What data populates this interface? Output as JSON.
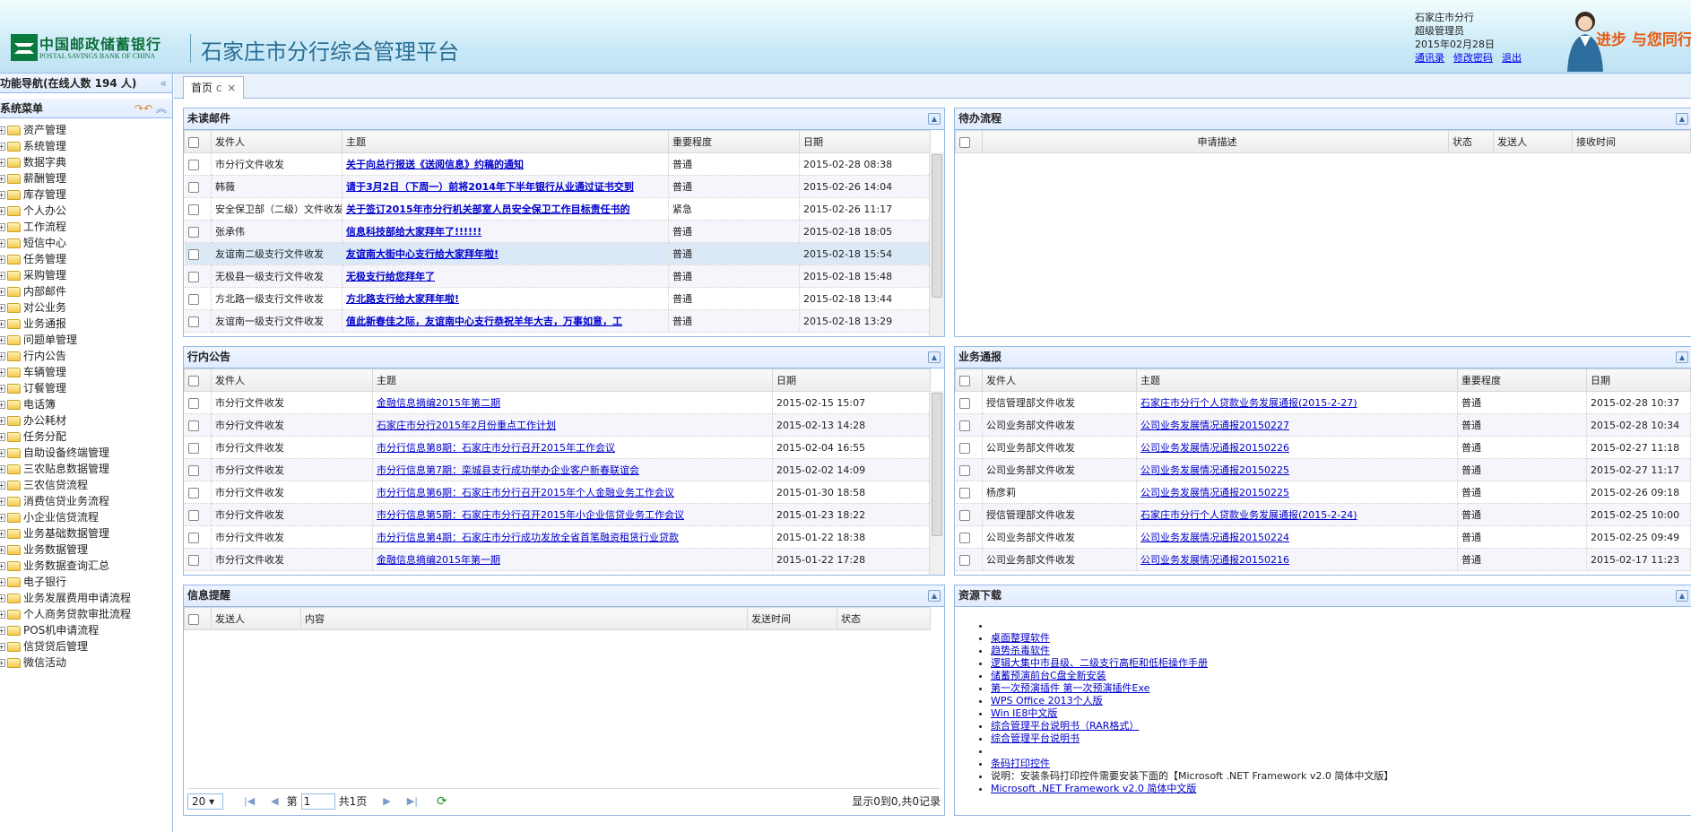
{
  "header": {
    "bank_cn": "中国邮政储蓄银行",
    "bank_en": "POSTAL SAVINGS BANK OF CHINA",
    "system_title": "石家庄市分行综合管理平台",
    "user": {
      "branch": "石家庄市分行",
      "role": "超级管理员",
      "date": "2015年02月28日",
      "links": [
        "通讯录",
        "修改密码",
        "退出"
      ]
    },
    "banner_slogan": "进步 与您同行"
  },
  "sidebar": {
    "nav_title": "功能导航(在线人数 194 人)",
    "menu_title": "系统菜单",
    "items": [
      "资产管理",
      "系统管理",
      "数据字典",
      "薪酬管理",
      "库存管理",
      "个人办公",
      "工作流程",
      "短信中心",
      "任务管理",
      "采购管理",
      "内部邮件",
      "对公业务",
      "业务通报",
      "问题单管理",
      "行内公告",
      "车辆管理",
      "订餐管理",
      "电话簿",
      "办公耗材",
      "任务分配",
      "自助设备终端管理",
      "三农贴息数据管理",
      "三农信贷流程",
      "消费信贷业务流程",
      "小企业信贷流程",
      "业务基础数据管理",
      "业务数据管理",
      "业务数据查询汇总",
      "电子银行",
      "业务发展费用申请流程",
      "个人商务贷款审批流程",
      "POS机申请流程",
      "信贷贷后管理",
      "微信活动"
    ]
  },
  "tabs": {
    "home": "首页"
  },
  "mail": {
    "title": "未读邮件",
    "columns": [
      "发件人",
      "主题",
      "重要程度",
      "日期"
    ],
    "rows": [
      [
        "市分行文件收发",
        "关于向总行报送《送阅信息》约稿的通知",
        "普通",
        "2015-02-28 08:38"
      ],
      [
        "韩薇",
        "请于3月2日（下周一）前将2014年下半年银行从业通过证书交到",
        "普通",
        "2015-02-26 14:04"
      ],
      [
        "安全保卫部（二级）文件收发",
        "关于签订2015年市分行机关部室人员安全保卫工作目标责任书的",
        "紧急",
        "2015-02-26 11:17"
      ],
      [
        "张承伟",
        "信息科技部给大家拜年了!!!!!!",
        "普通",
        "2015-02-18 18:05"
      ],
      [
        "友谊南二级支行文件收发",
        "友谊南大街中心支行给大家拜年啦!",
        "普通",
        "2015-02-18 15:54"
      ],
      [
        "无极县一级支行文件收发",
        "无极支行给您拜年了",
        "普通",
        "2015-02-18 15:48"
      ],
      [
        "方北路一级支行文件收发",
        "方北路支行给大家拜年啦!",
        "普通",
        "2015-02-18 13:44"
      ],
      [
        "友谊南一级支行文件收发",
        "值此新春佳之际，友谊南中心支行恭祝羊年大吉，万事如意，工",
        "普通",
        "2015-02-18 13:29"
      ]
    ]
  },
  "todo": {
    "title": "待办流程",
    "columns": [
      "申请描述",
      "状态",
      "发送人",
      "接收时间"
    ]
  },
  "notice": {
    "title": "行内公告",
    "columns": [
      "发件人",
      "主题",
      "日期"
    ],
    "rows": [
      [
        "市分行文件收发",
        "金融信息摘编2015年第二期",
        "2015-02-15 15:07"
      ],
      [
        "市分行文件收发",
        "石家庄市分行2015年2月份重点工作计划",
        "2015-02-13 14:28"
      ],
      [
        "市分行文件收发",
        "市分行信息第8期：石家庄市分行召开2015年工作会议",
        "2015-02-04 16:55"
      ],
      [
        "市分行文件收发",
        "市分行信息第7期：栾城县支行成功举办企业客户新春联谊会",
        "2015-02-02 14:09"
      ],
      [
        "市分行文件收发",
        "市分行信息第6期：石家庄市分行召开2015年个人金融业务工作会议",
        "2015-01-30 18:58"
      ],
      [
        "市分行文件收发",
        "市分行信息第5期：石家庄市分行召开2015年小企业信贷业务工作会议",
        "2015-01-23 18:22"
      ],
      [
        "市分行文件收发",
        "市分行信息第4期：石家庄市分行成功发放全省首笔融资租赁行业贷款",
        "2015-01-22 18:38"
      ],
      [
        "市分行文件收发",
        "金融信息摘编2015年第一期",
        "2015-01-22 17:28"
      ]
    ]
  },
  "business": {
    "title": "业务通报",
    "columns": [
      "发件人",
      "主题",
      "重要程度",
      "日期"
    ],
    "rows": [
      [
        "授信管理部文件收发",
        "石家庄市分行个人贷款业务发展通报(2015-2-27)",
        "普通",
        "2015-02-28 10:37"
      ],
      [
        "公司业务部文件收发",
        "公司业务发展情况通报20150227",
        "普通",
        "2015-02-28 10:34"
      ],
      [
        "公司业务部文件收发",
        "公司业务发展情况通报20150226",
        "普通",
        "2015-02-27 11:18"
      ],
      [
        "公司业务部文件收发",
        "公司业务发展情况通报20150225",
        "普通",
        "2015-02-27 11:17"
      ],
      [
        "杨彦莉",
        "公司业务发展情况通报20150225",
        "普通",
        "2015-02-26 09:18"
      ],
      [
        "授信管理部文件收发",
        "石家庄市分行个人贷款业务发展通报(2015-2-24)",
        "普通",
        "2015-02-25 10:00"
      ],
      [
        "公司业务部文件收发",
        "公司业务发展情况通报20150224",
        "普通",
        "2015-02-25 09:49"
      ],
      [
        "公司业务部文件收发",
        "公司业务发展情况通报20150216",
        "普通",
        "2015-02-17 11:23"
      ]
    ]
  },
  "info": {
    "title": "信息提醒",
    "columns": [
      "发送人",
      "内容",
      "发送时间",
      "状态"
    ],
    "pager": {
      "page_size": "20",
      "page_prefix": "第",
      "page_value": "1",
      "page_total": "共1页",
      "summary": "显示0到0,共0记录"
    }
  },
  "resources": {
    "title": "资源下载",
    "items": [
      {
        "text": "",
        "link": false
      },
      {
        "text": "桌面整理软件",
        "link": true
      },
      {
        "text": "趋势杀毒软件",
        "link": true
      },
      {
        "text": "逻辑大集中市县级、二级支行高柜和低柜操作手册",
        "link": true
      },
      {
        "text": "储蓄预演前台C盘全新安装",
        "link": true
      },
      {
        "text": "第一次预演插件     第一次预演插件Exe",
        "link": true
      },
      {
        "text": "WPS Office 2013个人版",
        "link": true
      },
      {
        "text": "Win IE8中文版",
        "link": true
      },
      {
        "text": "综合管理平台说明书（RAR格式）",
        "link": true
      },
      {
        "text": "综合管理平台说明书",
        "link": true
      },
      {
        "text": "",
        "link": false
      },
      {
        "text": "条码打印控件",
        "link": true
      },
      {
        "text": "说明：安装条码打印控件需要安装下面的【Microsoft .NET Framework v2.0 简体中文版】",
        "link": false
      },
      {
        "text": "Microsoft .NET Framework v2.0 简体中文版",
        "link": true
      }
    ]
  }
}
